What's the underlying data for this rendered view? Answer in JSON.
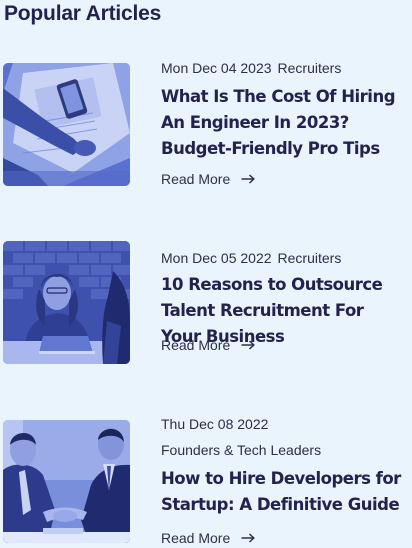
{
  "section": {
    "title": "Popular Articles"
  },
  "articles": [
    {
      "date": "Mon Dec 04 2023",
      "category": "Recruiters",
      "title": "What Is The Cost Of Hiring An Engineer In 2023? Budget-Friendly Pro Tips",
      "read_more": "Read More",
      "image": "analytics-desk-image"
    },
    {
      "date": "Mon Dec 05 2022",
      "category": "Recruiters",
      "title": "10 Reasons to Outsource Talent Recruitment For Your Business",
      "read_more": "Read More",
      "image": "office-meeting-image"
    },
    {
      "date": "Thu Dec 08 2022",
      "category": "Founders & Tech Leaders",
      "title": "How to Hire Developers for Startup: A Definitive Guide",
      "read_more": "Read More",
      "image": "handshake-image"
    }
  ],
  "colors": {
    "background": "#eaf4fd",
    "heading": "#23224f",
    "image_tint": "#4a5fbf"
  }
}
